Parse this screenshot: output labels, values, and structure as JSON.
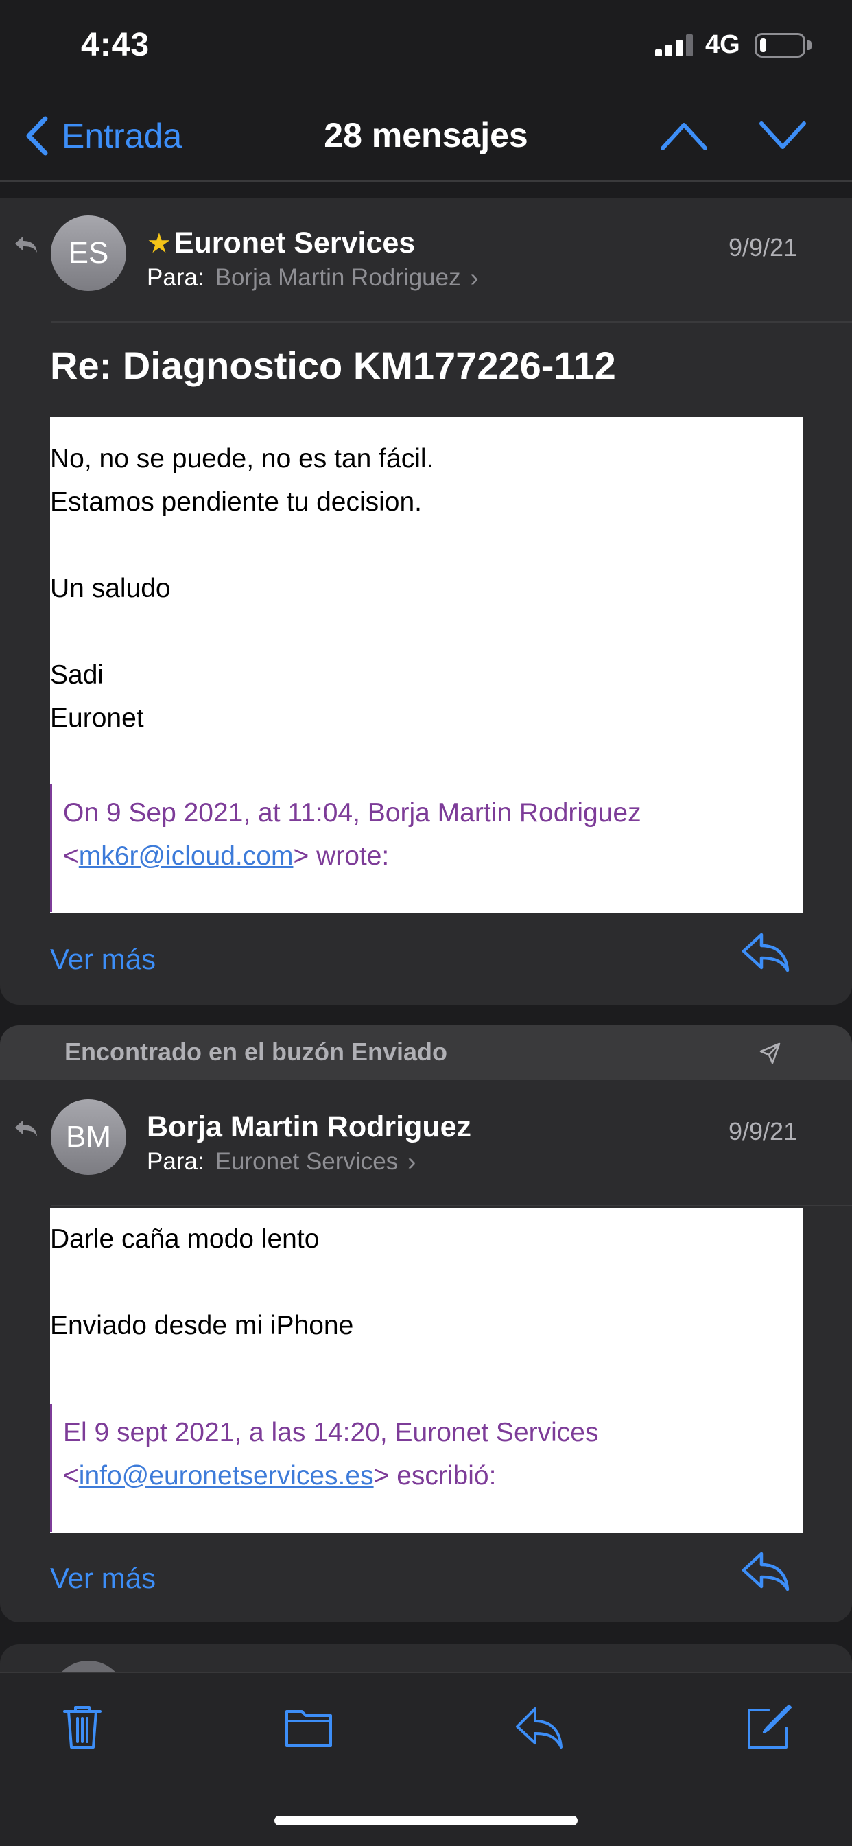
{
  "status_bar": {
    "time": "4:43",
    "network": "4G",
    "battery_level": 0.15
  },
  "nav": {
    "back_label": "Entrada",
    "title": "28 mensajes"
  },
  "messages": [
    {
      "avatar_initials": "ES",
      "sender": "Euronet Services",
      "starred": true,
      "to_label": "Para:",
      "recipient": "Borja Martin Rodriguez",
      "date": "9/9/21",
      "subject": "Re: Diagnostico KM177226-112",
      "body_lines": [
        "No, no se puede, no es tan fácil.",
        "Estamos pendiente tu decision.",
        "",
        "Un saludo",
        "",
        "Sadi",
        "Euronet"
      ],
      "quote": {
        "line1": "On 9 Sep 2021, at 11:04, Borja Martin Rodriguez",
        "prefix": "<",
        "email": "mk6r@icloud.com",
        "suffix": "> wrote:"
      },
      "more_label": "Ver más"
    },
    {
      "found_in": "Encontrado en el buzón Enviado",
      "avatar_initials": "BM",
      "sender": "Borja Martin Rodriguez",
      "starred": false,
      "to_label": "Para:",
      "recipient": "Euronet Services",
      "date": "9/9/21",
      "body_lines": [
        "Darle caña modo lento",
        "",
        "Enviado desde mi iPhone"
      ],
      "quote": {
        "line1": "El 9 sept 2021, a las 14:20, Euronet Services",
        "prefix": "<",
        "email": "info@euronetservices.es",
        "suffix": "> escribió:"
      },
      "more_label": "Ver más"
    }
  ],
  "toolbar": [
    "trash-icon",
    "folder-icon",
    "reply-icon",
    "compose-icon"
  ],
  "colors": {
    "accent": "#3d8ef7",
    "quote": "#7d3c98",
    "background": "#1c1c1e",
    "card": "#2c2c2e"
  }
}
